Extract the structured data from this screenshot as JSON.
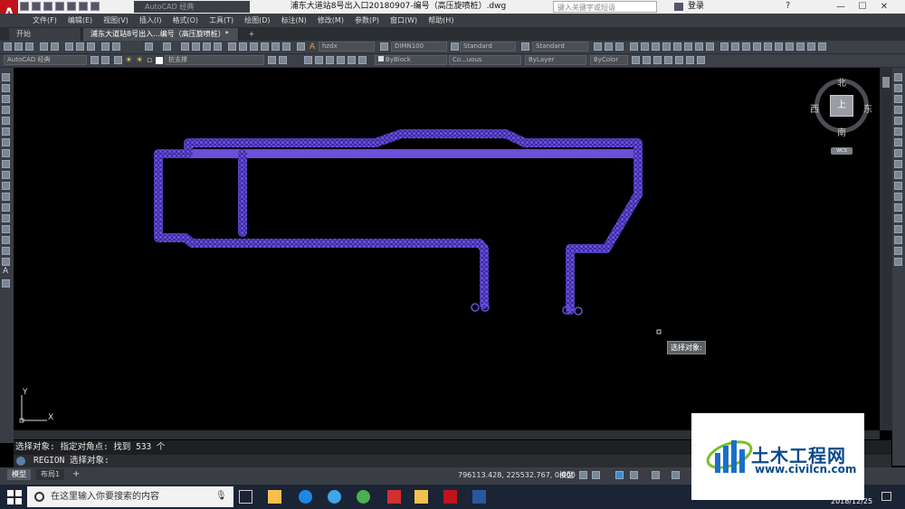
{
  "app": {
    "document_title": "浦东大道站8号出入口20180907-编号（高压旋喷桩）.dwg",
    "workspace": "AutoCAD 经典",
    "search_placeholder": "键入关键字或短语",
    "login_label": "登录",
    "brand_color": "#c1131b"
  },
  "menu": [
    "文件(F)",
    "编辑(E)",
    "视图(V)",
    "插入(I)",
    "格式(O)",
    "工具(T)",
    "绘图(D)",
    "标注(N)",
    "修改(M)",
    "参数(P)",
    "窗口(W)",
    "帮助(H)"
  ],
  "tabs": [
    {
      "label": "开始"
    },
    {
      "label": "浦东大道站8号出入...编号（高压旋喷桩）*"
    }
  ],
  "toolbar": {
    "text_style": "hzdx",
    "dim_style": "DIMN100",
    "table_style": "Standard",
    "multileader_style": "Standard",
    "workspace_select": "AutoCAD 经典",
    "layer": "桩支撑",
    "color": "ByBlock",
    "linetype": "Co...uous",
    "lineweight": "ByLayer",
    "plot_style": "ByColor"
  },
  "viewcube": {
    "north": "北",
    "south": "南",
    "east": "东",
    "west": "西",
    "top": "上",
    "wcs": "WCS"
  },
  "ucs": {
    "x": "X",
    "y": "Y"
  },
  "cursor_tooltip": "选择对象:",
  "command": {
    "history": "选择对象: 指定对角点: 找到 533 个",
    "prompt": "REGION 选择对象:"
  },
  "layouts": [
    "模型",
    "布局1"
  ],
  "status": {
    "coordinates": "796113.428, 225532.767, 0.000",
    "model_label": "模型"
  },
  "taskbar": {
    "search_placeholder": "在这里输入你要搜索的内容",
    "date": "2018/12/25"
  },
  "watermark": {
    "title": "土木工程网",
    "url": "www.civilcn.com"
  },
  "colors": {
    "selection": "#6a4fd8",
    "canvas": "#000000"
  }
}
